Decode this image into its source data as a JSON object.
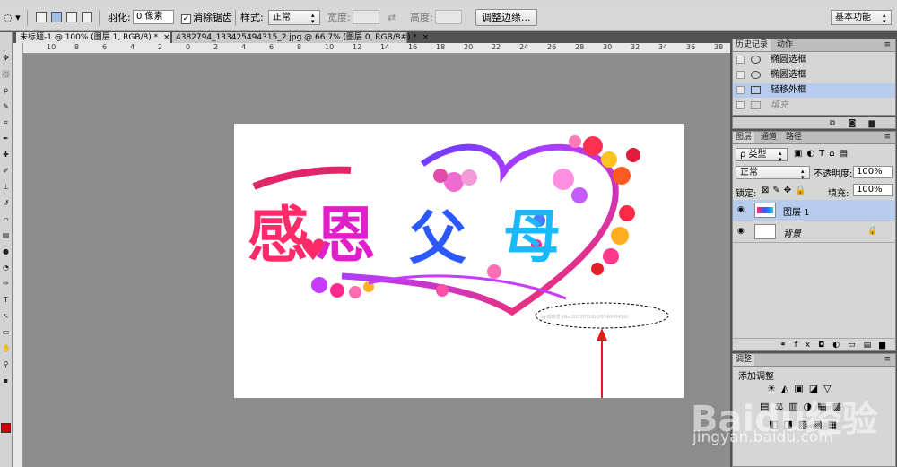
{
  "options_bar": {
    "feather_label": "羽化:",
    "feather_value": "0 像素",
    "antialias_label": "消除锯齿",
    "style_label": "样式:",
    "style_value": "正常",
    "width_label": "宽度:",
    "height_label": "高度:",
    "refine_edge_button": "调整边缘...",
    "workspace": "基本功能"
  },
  "document_tabs": [
    {
      "label": "未标题-1 @ 100% (图层 1, RGB/8) *",
      "close": "×"
    },
    {
      "label": "4382794_133425494315_2.jpg @ 66.7% (图层 0, RGB/8#) *",
      "close": "×"
    }
  ],
  "ruler": {
    "h_ticks": [
      "10",
      "8",
      "6",
      "4",
      "2",
      "0",
      "2",
      "4",
      "6",
      "8",
      "10",
      "12",
      "14",
      "16",
      "18",
      "20",
      "22",
      "24",
      "26",
      "28",
      "30",
      "32",
      "34",
      "36",
      "38"
    ]
  },
  "canvas": {
    "headline": "感恩父母",
    "char1": "感",
    "char2": "恩",
    "char3": "父",
    "char4": "母",
    "small_text": "by.微微爱 (No.20130718)(2014040419)"
  },
  "history_panel": {
    "tabs": [
      "历史记录",
      "动作"
    ],
    "items": [
      {
        "label": "椭圆选框",
        "icon": "ellipse-select-icon"
      },
      {
        "label": "椭圆选框",
        "icon": "ellipse-select-icon"
      },
      {
        "label": "轻移外框",
        "icon": "document-icon"
      },
      {
        "label": "填充",
        "icon": "document-icon"
      }
    ]
  },
  "layers_panel": {
    "tabs": [
      "图层",
      "通道",
      "路径"
    ],
    "filter_label": "ρ 类型",
    "blend_mode": "正常",
    "opacity_label": "不透明度:",
    "opacity_value": "100%",
    "lock_label": "锁定:",
    "fill_label": "填充:",
    "fill_value": "100%",
    "layers": [
      {
        "name": "图层 1"
      },
      {
        "name": "背景"
      }
    ]
  },
  "adjust_panel": {
    "tab": "调整",
    "title": "添加调整"
  },
  "watermark": {
    "brand": "Baidu经验",
    "url": "jingyan.baidu.com"
  },
  "colors": {
    "selection_blue": "#b6cbee",
    "foreground": "#cc0000",
    "arrow_red": "#e01c1c"
  }
}
